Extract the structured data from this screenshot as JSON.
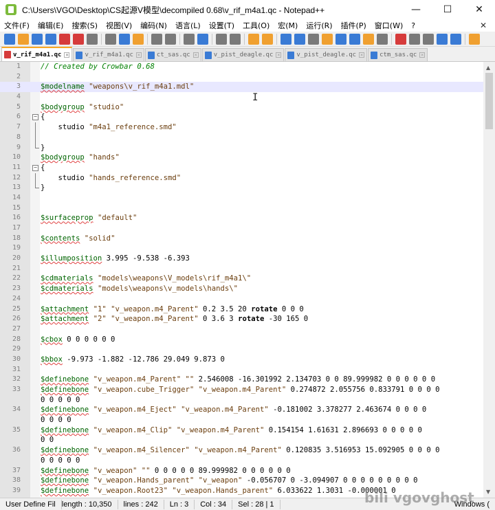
{
  "window": {
    "title": "C:\\Users\\VGO\\Desktop\\CS起源V模型\\decompiled 0.68\\v_rif_m4a1.qc - Notepad++",
    "minimize": "—",
    "maximize": "☐",
    "close": "✕"
  },
  "menu": {
    "items": [
      "文件(F)",
      "编辑(E)",
      "搜索(S)",
      "视图(V)",
      "编码(N)",
      "语言(L)",
      "设置(T)",
      "工具(O)",
      "宏(M)",
      "运行(R)",
      "插件(P)",
      "窗口(W)",
      "?"
    ],
    "close_glyph": "✕"
  },
  "toolbar": {
    "icons": [
      "new-file-icon",
      "open-file-icon",
      "save-icon",
      "save-all-icon",
      "close-file-icon",
      "close-all-icon",
      "print-icon",
      "cut-icon",
      "copy-icon",
      "paste-icon",
      "undo-icon",
      "redo-icon",
      "find-icon",
      "replace-icon",
      "zoom-in-icon",
      "zoom-out-icon",
      "sync-vertical-icon",
      "sync-horizontal-icon",
      "word-wrap-icon",
      "show-all-chars-icon",
      "indent-guide-icon",
      "udl-icon",
      "doc-map-icon",
      "function-list-icon",
      "folder-workspace-icon",
      "monitor-icon",
      "record-macro-icon",
      "stop-record-icon",
      "play-macro-icon",
      "run-macro-multiple-icon",
      "save-macro-icon",
      "spellcheck-icon"
    ],
    "colors": {
      "blue": "#3a7bd5",
      "green": "#4caf50",
      "red": "#d63b3b",
      "orange": "#f0a030",
      "gray": "#7a7a7a"
    }
  },
  "tabs": [
    {
      "label": "v_rif_m4a1.qc",
      "active": true
    },
    {
      "label": "v_rif_m4a1.qc",
      "active": false
    },
    {
      "label": "ct_sas.qc",
      "active": false
    },
    {
      "label": "v_pist_deagle.qc",
      "active": false
    },
    {
      "label": "v_pist_deagle.qc",
      "active": false
    },
    {
      "label": "ctm_sas.qc",
      "active": false
    }
  ],
  "editor": {
    "current_line": 3,
    "lines": [
      {
        "n": "1",
        "tokens": [
          [
            "comment",
            "// Created by Crowbar 0.68"
          ]
        ]
      },
      {
        "n": "2",
        "tokens": []
      },
      {
        "n": "3",
        "tokens": [
          [
            "kw",
            "$modelname"
          ],
          [
            "txt",
            " "
          ],
          [
            "str",
            "\"weapons\\v_rif_m4a1.mdl\""
          ]
        ]
      },
      {
        "n": "4",
        "tokens": []
      },
      {
        "n": "5",
        "tokens": [
          [
            "kw",
            "$bodygroup"
          ],
          [
            "txt",
            " "
          ],
          [
            "str",
            "\"studio\""
          ]
        ]
      },
      {
        "n": "6",
        "fold": "open",
        "tokens": [
          [
            "txt",
            "{"
          ]
        ]
      },
      {
        "n": "7",
        "fold": "line",
        "tokens": [
          [
            "txt",
            "    studio "
          ],
          [
            "str",
            "\"m4a1_reference.smd\""
          ]
        ]
      },
      {
        "n": "8",
        "fold": "line",
        "tokens": []
      },
      {
        "n": "9",
        "fold": "end",
        "tokens": [
          [
            "txt",
            "}"
          ]
        ]
      },
      {
        "n": "10",
        "tokens": [
          [
            "kw",
            "$bodygroup"
          ],
          [
            "txt",
            " "
          ],
          [
            "str",
            "\"hands\""
          ]
        ]
      },
      {
        "n": "11",
        "fold": "open",
        "tokens": [
          [
            "txt",
            "{"
          ]
        ]
      },
      {
        "n": "12",
        "fold": "line",
        "tokens": [
          [
            "txt",
            "    studio "
          ],
          [
            "str",
            "\"hands_reference.smd\""
          ]
        ]
      },
      {
        "n": "13",
        "fold": "end",
        "tokens": [
          [
            "txt",
            "}"
          ]
        ]
      },
      {
        "n": "14",
        "tokens": []
      },
      {
        "n": "15",
        "tokens": []
      },
      {
        "n": "16",
        "tokens": [
          [
            "kw",
            "$surfaceprop"
          ],
          [
            "txt",
            " "
          ],
          [
            "str",
            "\"default\""
          ]
        ]
      },
      {
        "n": "17",
        "tokens": []
      },
      {
        "n": "18",
        "tokens": [
          [
            "kw",
            "$contents"
          ],
          [
            "txt",
            " "
          ],
          [
            "str",
            "\"solid\""
          ]
        ]
      },
      {
        "n": "19",
        "tokens": []
      },
      {
        "n": "20",
        "tokens": [
          [
            "kw",
            "$illumposition"
          ],
          [
            "num",
            " 3.995 -9.538 -6.393"
          ]
        ]
      },
      {
        "n": "21",
        "tokens": []
      },
      {
        "n": "22",
        "tokens": [
          [
            "kw",
            "$cdmaterials"
          ],
          [
            "txt",
            " "
          ],
          [
            "str",
            "\"models\\weapons\\V_models\\rif_m4a1\\\""
          ]
        ]
      },
      {
        "n": "23",
        "tokens": [
          [
            "kw",
            "$cdmaterials"
          ],
          [
            "txt",
            " "
          ],
          [
            "str",
            "\"models\\weapons\\v_models\\hands\\\""
          ]
        ]
      },
      {
        "n": "24",
        "tokens": []
      },
      {
        "n": "25",
        "tokens": [
          [
            "kw",
            "$attachment"
          ],
          [
            "txt",
            " "
          ],
          [
            "str",
            "\"1\""
          ],
          [
            "txt",
            " "
          ],
          [
            "str",
            "\"v_weapon.m4_Parent\""
          ],
          [
            "num",
            " 0.2 3.5 20 "
          ],
          [
            "rot",
            "rotate"
          ],
          [
            "num",
            " 0 0 0"
          ]
        ]
      },
      {
        "n": "26",
        "tokens": [
          [
            "kw",
            "$attachment"
          ],
          [
            "txt",
            " "
          ],
          [
            "str",
            "\"2\""
          ],
          [
            "txt",
            " "
          ],
          [
            "str",
            "\"v_weapon.m4_Parent\""
          ],
          [
            "num",
            " 0 3.6 3 "
          ],
          [
            "rot",
            "rotate"
          ],
          [
            "num",
            " -30 165 0"
          ]
        ]
      },
      {
        "n": "27",
        "tokens": []
      },
      {
        "n": "28",
        "tokens": [
          [
            "kw",
            "$cbox"
          ],
          [
            "num",
            " 0 0 0 0 0 0"
          ]
        ]
      },
      {
        "n": "29",
        "tokens": []
      },
      {
        "n": "30",
        "tokens": [
          [
            "kw",
            "$bbox"
          ],
          [
            "num",
            " -9.973 -1.882 -12.786 29.049 9.873 0"
          ]
        ]
      },
      {
        "n": "31",
        "tokens": []
      },
      {
        "n": "32",
        "tokens": [
          [
            "kw",
            "$definebone"
          ],
          [
            "txt",
            " "
          ],
          [
            "str",
            "\"v_weapon.m4_Parent\""
          ],
          [
            "txt",
            " "
          ],
          [
            "str",
            "\"\""
          ],
          [
            "num",
            " 2.546008 -16.301992 2.134703 0 0 89.999982 0 0 0 0 0 0"
          ]
        ]
      },
      {
        "n": "33",
        "tokens": [
          [
            "kw",
            "$definebone"
          ],
          [
            "txt",
            " "
          ],
          [
            "str",
            "\"v_weapon.cube_Trigger\""
          ],
          [
            "txt",
            " "
          ],
          [
            "str",
            "\"v_weapon.m4_Parent\""
          ],
          [
            "num",
            " 0.274872 2.055756 0.833791 0 0 0 0"
          ]
        ]
      },
      {
        "n": "",
        "tokens": [
          [
            "num",
            "0 0 0 0 0"
          ]
        ]
      },
      {
        "n": "34",
        "tokens": [
          [
            "kw",
            "$definebone"
          ],
          [
            "txt",
            " "
          ],
          [
            "str",
            "\"v_weapon.m4_Eject\""
          ],
          [
            "txt",
            " "
          ],
          [
            "str",
            "\"v_weapon.m4_Parent\""
          ],
          [
            "num",
            " -0.181002 3.378277 2.463674 0 0 0 0"
          ]
        ]
      },
      {
        "n": "",
        "tokens": [
          [
            "num",
            "0 0 0 0"
          ]
        ]
      },
      {
        "n": "35",
        "tokens": [
          [
            "kw",
            "$definebone"
          ],
          [
            "txt",
            " "
          ],
          [
            "str",
            "\"v_weapon.m4_Clip\""
          ],
          [
            "txt",
            " "
          ],
          [
            "str",
            "\"v_weapon.m4_Parent\""
          ],
          [
            "num",
            " 0.154154 1.61631 2.896693 0 0 0 0 0"
          ]
        ]
      },
      {
        "n": "",
        "tokens": [
          [
            "num",
            "0 0"
          ]
        ]
      },
      {
        "n": "36",
        "tokens": [
          [
            "kw",
            "$definebone"
          ],
          [
            "txt",
            " "
          ],
          [
            "str",
            "\"v_weapon.m4_Silencer\""
          ],
          [
            "txt",
            " "
          ],
          [
            "str",
            "\"v_weapon.m4_Parent\""
          ],
          [
            "num",
            " 0.120835 3.516953 15.092905 0 0 0 0"
          ]
        ]
      },
      {
        "n": "",
        "tokens": [
          [
            "num",
            "0 0 0 0 0"
          ]
        ]
      },
      {
        "n": "37",
        "tokens": [
          [
            "kw",
            "$definebone"
          ],
          [
            "txt",
            " "
          ],
          [
            "str",
            "\"v_weapon\""
          ],
          [
            "txt",
            " "
          ],
          [
            "str",
            "\"\""
          ],
          [
            "num",
            " 0 0 0 0 0 89.999982 0 0 0 0 0 0"
          ]
        ]
      },
      {
        "n": "38",
        "tokens": [
          [
            "kw",
            "$definebone"
          ],
          [
            "txt",
            " "
          ],
          [
            "str",
            "\"v_weapon.Hands_parent\""
          ],
          [
            "txt",
            " "
          ],
          [
            "str",
            "\"v_weapon\""
          ],
          [
            "num",
            " -0.056707 0 -3.094907 0 0 0 0 0 0 0 0 0"
          ]
        ]
      },
      {
        "n": "39",
        "tokens": [
          [
            "kw",
            "$definebone"
          ],
          [
            "txt",
            " "
          ],
          [
            "str",
            "\"v_weapon.Root23\""
          ],
          [
            "txt",
            " "
          ],
          [
            "str",
            "\"v_weapon.Hands_parent\""
          ],
          [
            "num",
            " 6.033622 1.3031 -0.000001 0"
          ]
        ]
      }
    ]
  },
  "statusbar": {
    "lang": "User Define Fil",
    "length": "length : 10,350",
    "lines": "lines : 242",
    "ln": "Ln : 3",
    "col": "Col : 34",
    "sel": "Sel : 28 | 1",
    "eol": "Windows (",
    "watermark": "bili vgovghost"
  }
}
